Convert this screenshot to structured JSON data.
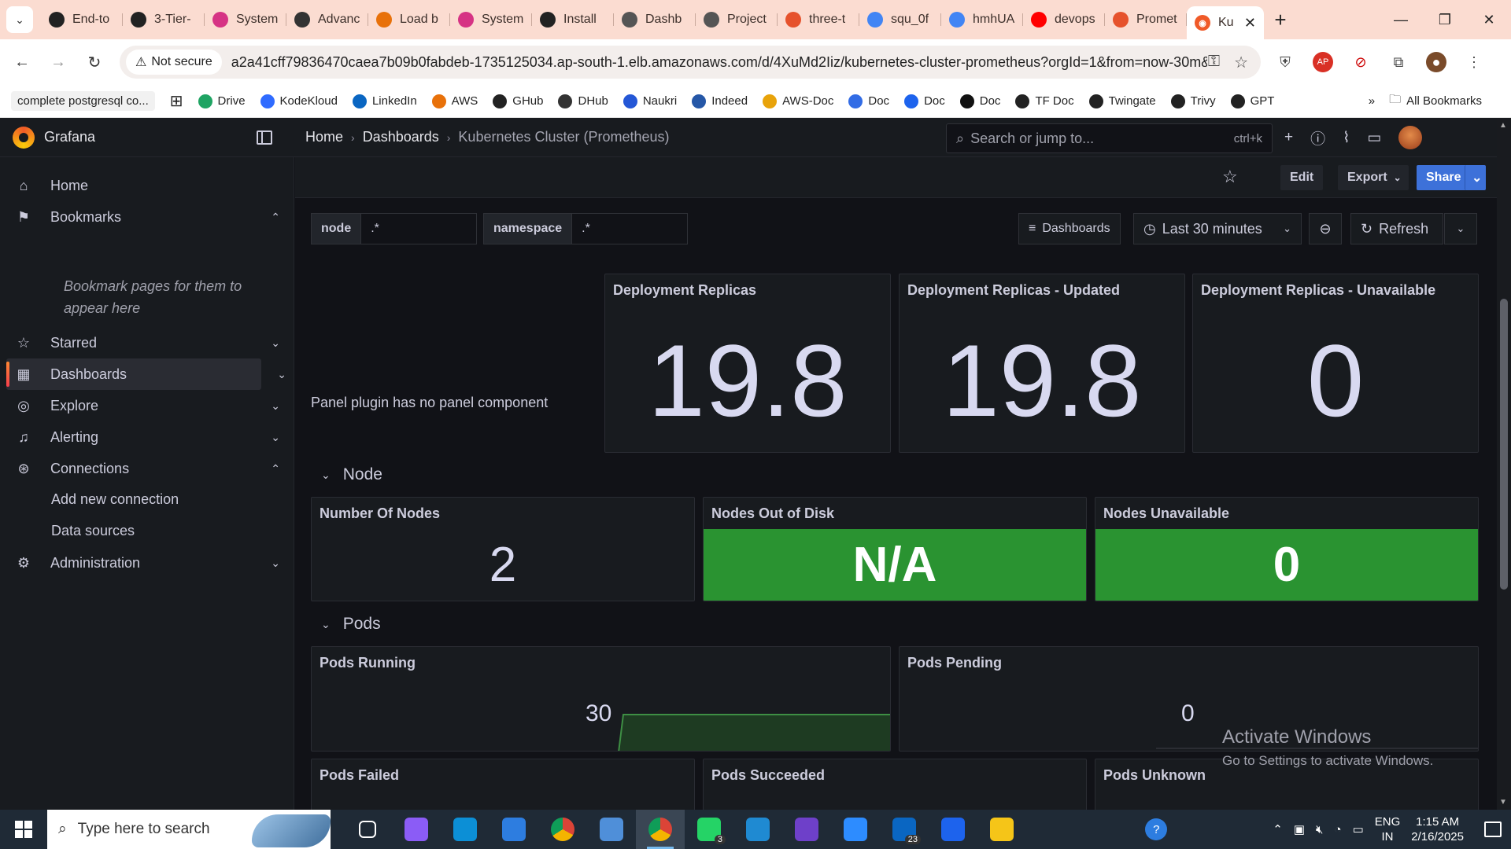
{
  "browser": {
    "tabs": [
      {
        "title": "End-to",
        "icon": "github-icon",
        "color": "#222222"
      },
      {
        "title": "3-Tier-",
        "icon": "github-icon",
        "color": "#222222"
      },
      {
        "title": "System",
        "icon": "app-icon",
        "color": "#d63384"
      },
      {
        "title": "Advanc",
        "icon": "graduation-icon",
        "color": "#333333"
      },
      {
        "title": "Load b",
        "icon": "aws-icon",
        "color": "#e8710a"
      },
      {
        "title": "System",
        "icon": "app-icon",
        "color": "#d63384"
      },
      {
        "title": "Install",
        "icon": "circle-icon",
        "color": "#222222"
      },
      {
        "title": "Dashb",
        "icon": "jenkins-icon",
        "color": "#555555"
      },
      {
        "title": "Project",
        "icon": "project-icon",
        "color": "#555555"
      },
      {
        "title": "three-t",
        "icon": "prometheus-icon",
        "color": "#e6522c"
      },
      {
        "title": "squ_0f",
        "icon": "google-icon",
        "color": "#4285f4"
      },
      {
        "title": "hmhUA",
        "icon": "google-icon",
        "color": "#4285f4"
      },
      {
        "title": "devops",
        "icon": "youtube-icon",
        "color": "#ff0000"
      },
      {
        "title": "Promet",
        "icon": "prometheus-icon",
        "color": "#e6522c"
      }
    ],
    "active_tab": {
      "title": "Ku",
      "icon": "grafana-icon",
      "close": "✕"
    },
    "new_tab": "+",
    "url": "a2a41cff79836470caea7b09b0fabdeb-1735125034.ap-south-1.elb.amazonaws.com/d/4XuMd2Iiz/kubernetes-cluster-prometheus?orgId=1&from=now-30m&t...",
    "security_chip": "Not secure",
    "bookmarks": [
      {
        "label": "complete postgresql co...",
        "icon": ""
      },
      {
        "label": "Drive",
        "icon": "drive-icon",
        "color": "#1fa463"
      },
      {
        "label": "KodeKloud",
        "icon": "kodekloud-icon",
        "color": "#2f6bff"
      },
      {
        "label": "LinkedIn",
        "icon": "linkedin-icon",
        "color": "#0a66c2"
      },
      {
        "label": "AWS",
        "icon": "aws-icon",
        "color": "#e8710a"
      },
      {
        "label": "GHub",
        "icon": "github-icon",
        "color": "#222222"
      },
      {
        "label": "DHub",
        "icon": "dockerhub-icon",
        "color": "#333333"
      },
      {
        "label": "Naukri",
        "icon": "naukri-icon",
        "color": "#2457d6"
      },
      {
        "label": "Indeed",
        "icon": "indeed-icon",
        "color": "#2557a7"
      },
      {
        "label": "AWS-Doc",
        "icon": "aws-icon",
        "color": "#e8a30a"
      },
      {
        "label": "Doc",
        "icon": "k8s-icon",
        "color": "#326ce5"
      },
      {
        "label": "Doc",
        "icon": "docker-icon",
        "color": "#1d63ed"
      },
      {
        "label": "Doc",
        "icon": "ansible-icon",
        "color": "#111111"
      },
      {
        "label": "TF Doc",
        "icon": "terraform-icon",
        "color": "#222222"
      },
      {
        "label": "Twingate",
        "icon": "twingate-icon",
        "color": "#222222"
      },
      {
        "label": "Trivy",
        "icon": "trivy-icon",
        "color": "#222222"
      },
      {
        "label": "GPT",
        "icon": "openai-icon",
        "color": "#222222"
      }
    ],
    "more_bookmarks": "»",
    "all_bookmarks": "All Bookmarks"
  },
  "grafana": {
    "brand": "Grafana",
    "breadcrumbs": [
      "Home",
      "Dashboards",
      "Kubernetes Cluster (Prometheus)"
    ],
    "search_placeholder": "Search or jump to...",
    "search_shortcut": "ctrl+k",
    "add_label": "+",
    "nav": [
      {
        "label": "Home",
        "icon": "home-icon"
      },
      {
        "label": "Bookmarks",
        "icon": "bookmark-icon",
        "chevron": "⌃"
      },
      {
        "label": "Starred",
        "icon": "star-icon",
        "chevron": "⌄"
      },
      {
        "label": "Dashboards",
        "icon": "dashboards-icon",
        "chevron": "⌄"
      },
      {
        "label": "Explore",
        "icon": "compass-icon",
        "chevron": "⌄"
      },
      {
        "label": "Alerting",
        "icon": "bell-icon",
        "chevron": "⌄"
      },
      {
        "label": "Connections",
        "icon": "connections-icon",
        "chevron": "⌃"
      },
      {
        "label": "Administration",
        "icon": "gear-icon",
        "chevron": "⌄"
      }
    ],
    "bookmarks_empty": "Bookmark pages for them to appear here",
    "connections_sub": [
      "Add new connection",
      "Data sources"
    ],
    "toolbar": {
      "edit": "Edit",
      "export": "Export",
      "share": "Share"
    },
    "variables": [
      {
        "name": "node",
        "value": ".*"
      },
      {
        "name": "namespace",
        "value": ".*"
      }
    ],
    "controls": {
      "dashboards": "Dashboards",
      "time_range": "Last 30 minutes",
      "refresh": "Refresh"
    },
    "panel_plugin_msg": "Panel plugin has no panel component",
    "stats_top": [
      {
        "title": "Deployment Replicas",
        "value": "19.8"
      },
      {
        "title": "Deployment Replicas - Updated",
        "value": "19.8"
      },
      {
        "title": "Deployment Replicas - Unavailable",
        "value": "0"
      }
    ],
    "row_node": "Node",
    "stats_node": [
      {
        "title": "Number Of Nodes",
        "value": "2"
      },
      {
        "title": "Nodes Out of Disk",
        "value": "N/A"
      },
      {
        "title": "Nodes Unavailable",
        "value": "0"
      }
    ],
    "row_pods": "Pods",
    "stats_pods": [
      {
        "title": "Pods Running",
        "value": "30"
      },
      {
        "title": "Pods Pending",
        "value": "0"
      }
    ],
    "stats_pods2": [
      {
        "title": "Pods Failed"
      },
      {
        "title": "Pods Succeeded"
      },
      {
        "title": "Pods Unknown"
      }
    ],
    "colors": {
      "green": "#2a9331",
      "share": "#3d71d9",
      "orange": "#f05a28"
    }
  },
  "watermark": {
    "line1": "Activate Windows",
    "line2": "Go to Settings to activate Windows."
  },
  "taskbar": {
    "search_placeholder": "Type here to search",
    "apps": [
      {
        "name": "task-view-icon",
        "color": "#ffffff"
      },
      {
        "name": "copilot-icon",
        "color": "#8b5cf6"
      },
      {
        "name": "edge-icon",
        "color": "#0c8fd6"
      },
      {
        "name": "store-icon",
        "color": "#2d7de0"
      },
      {
        "name": "chrome-icon",
        "color": "#db4437"
      },
      {
        "name": "files-icon",
        "color": "#4f8fd9"
      },
      {
        "name": "chrome-active-icon",
        "color": "#db4437"
      },
      {
        "name": "whatsapp-icon",
        "color": "#25d366",
        "badge": "3"
      },
      {
        "name": "vscode-icon",
        "color": "#1f8ad2"
      },
      {
        "name": "github-desktop-icon",
        "color": "#6e40c9"
      },
      {
        "name": "zoom-icon",
        "color": "#2d8cff"
      },
      {
        "name": "linkedin-app-icon",
        "color": "#0a66c2",
        "badge": "23"
      },
      {
        "name": "docker-app-icon",
        "color": "#1d63ed"
      },
      {
        "name": "explorer-icon",
        "color": "#f5c518"
      }
    ],
    "lang": [
      "ENG",
      "IN"
    ],
    "time": "1:15 AM",
    "date": "2/16/2025"
  }
}
